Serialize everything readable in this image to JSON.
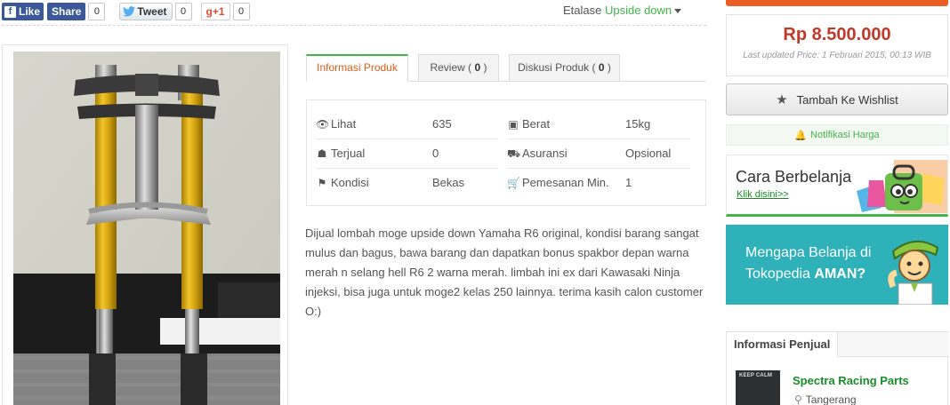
{
  "social": {
    "like_label": "Like",
    "share_label": "Share",
    "facebook_count": "0",
    "tweet_label": "Tweet",
    "tweet_count": "0",
    "gplus_label": "g+1",
    "gplus_count": "0"
  },
  "etalase": {
    "label": "Etalase",
    "value": "Upside down"
  },
  "tabs": [
    {
      "label": "Informasi Produk",
      "count": ""
    },
    {
      "label": "Review ( ",
      "count": "0",
      "suffix": " )"
    },
    {
      "label": "Diskusi Produk ( ",
      "count": "0",
      "suffix": " )"
    }
  ],
  "info": {
    "rows": [
      {
        "icon": "eye-icon",
        "label": "Lihat",
        "value": "635"
      },
      {
        "icon": "basket-icon",
        "label": "Terjual",
        "value": "0"
      },
      {
        "icon": "tag-icon",
        "label": "Kondisi",
        "value": "Bekas"
      }
    ],
    "rows_right": [
      {
        "icon": "weight-icon",
        "label": "Berat",
        "value": "15kg"
      },
      {
        "icon": "truck-icon",
        "label": "Asuransi",
        "value": "Opsional"
      },
      {
        "icon": "cart-icon",
        "label": "Pemesanan Min.",
        "value": "1"
      }
    ]
  },
  "description": "Dijual lombah moge upside down Yamaha R6 original, kondisi barang sangat mulus dan bagus, bawa barang dan dapatkan bonus spakbor depan warna merah n selang hell R6 2 warna merah. limbah ini ex dari Kawasaki Ninja injeksi, bisa juga untuk moge2 kelas 250 lainnya. terima kasih calon customer O:)",
  "price": {
    "amount": "Rp 8.500.000",
    "updated": "Last updated Price: 1 Februari 2015, 00:13 WIB"
  },
  "wishlist_label": "Tambah Ke Wishlist",
  "notif_label": "Notifikasi Harga",
  "banner1": {
    "title": "Cara Berbelanja",
    "link": "Klik disini>>"
  },
  "banner2": {
    "line1": "Mengapa Belanja di",
    "line2_prefix": "Tokopedia ",
    "line2_bold": "AMAN?"
  },
  "seller": {
    "section_title": "Informasi Penjual",
    "avatar_text": "KEEP CALM",
    "name": "Spectra Racing Parts",
    "location": "Tangerang"
  },
  "colors": {
    "brand_green": "#42b549",
    "price_red": "#c0392b",
    "accent_orange": "#e95d25",
    "banner_teal": "#2eb1b8"
  }
}
